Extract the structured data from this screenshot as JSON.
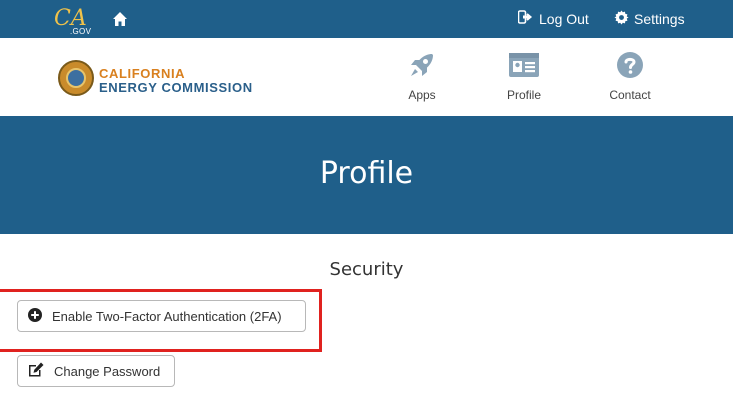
{
  "topbar": {
    "logo_text": "CA",
    "logo_suffix": ".GOV",
    "logout_label": "Log Out",
    "settings_label": "Settings"
  },
  "header": {
    "org_line1": "CALIFORNIA",
    "org_line2": "ENERGY COMMISSION",
    "nav": [
      {
        "label": "Apps",
        "icon": "rocket-icon"
      },
      {
        "label": "Profile",
        "icon": "id-card-icon"
      },
      {
        "label": "Contact",
        "icon": "question-circle-icon"
      }
    ]
  },
  "banner": {
    "title": "Profile"
  },
  "security": {
    "title": "Security",
    "enable_2fa_label": "Enable Two-Factor Authentication (2FA)",
    "change_password_label": "Change Password"
  },
  "colors": {
    "primary": "#1f5f8a",
    "accent_orange": "#d9801f",
    "highlight": "#e0221f"
  }
}
